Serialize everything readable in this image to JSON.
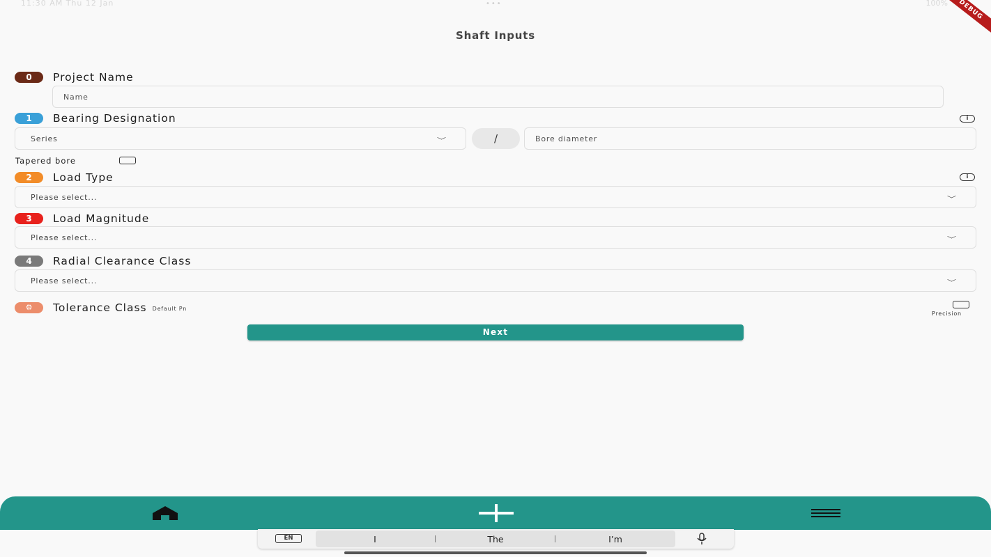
{
  "status_bar": {
    "left_text": "11:30 AM  Thu 12 Jan",
    "dots": "•••",
    "right_text": "100%"
  },
  "debug_banner": "DEBUG",
  "title": "Shaft Inputs",
  "sections": {
    "project": {
      "badge": "0",
      "badge_color": "#6b2a17",
      "label": "Project Name",
      "placeholder": "Name",
      "value": ""
    },
    "bearing": {
      "badge": "1",
      "badge_color": "#3aa0d8",
      "label": "Bearing Designation",
      "series_select": "Series",
      "slash": "/",
      "bore_placeholder": "Bore diameter",
      "tapered_label": "Tapered bore",
      "info_icon": "info-icon"
    },
    "load_type": {
      "badge": "2",
      "badge_color": "#f28c28",
      "label": "Load Type",
      "select": "Please select..."
    },
    "load_magnitude": {
      "badge": "3",
      "badge_color": "#e8211c",
      "label": "Load Magnitude",
      "select": "Please select..."
    },
    "radial_clearance": {
      "badge": "4",
      "badge_color": "#7a7a7a",
      "label": "Radial Clearance Class",
      "select": "Please select..."
    },
    "tolerance": {
      "icon": "settings-icon",
      "label": "Tolerance Class",
      "sub": "Default Pn",
      "precision_label": "Precision"
    }
  },
  "next_label": "Next",
  "bottom_nav": {
    "items": [
      "home-icon",
      "add-icon",
      "menu-icon"
    ],
    "color": "#23958a"
  },
  "keyboard": {
    "lang": "EN",
    "suggestions": [
      "I",
      "The",
      "I’m"
    ]
  }
}
